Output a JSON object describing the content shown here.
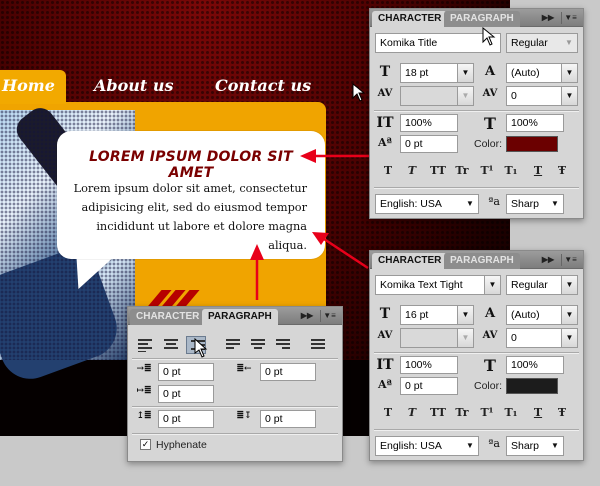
{
  "mockup": {
    "nav": [
      "Home",
      "About us",
      "Contact us"
    ],
    "bubble": {
      "title": "LOREM IPSUM DOLOR SIT AMET",
      "body": "Lorem ipsum dolor sit amet, consectetur adipisicing elit, sed do eiusmod tempor incididunt ut labore et dolore magna aliqua."
    },
    "colors": {
      "nav_tab": "#f2a900",
      "title_text": "#7a0000",
      "background": "#4a0202",
      "arrow": "#e8001a"
    }
  },
  "character_top": {
    "tabs": [
      "CHARACTER",
      "PARAGRAPH"
    ],
    "font_family": "Komika Title",
    "font_style": "Regular",
    "font_size": "18 pt",
    "leading": "(Auto)",
    "kerning": "",
    "tracking": "0",
    "vertical_scale": "100%",
    "horizontal_scale": "100%",
    "baseline_shift": "0 pt",
    "color_label": "Color:",
    "color": "#6b0000",
    "style_buttons": [
      "T",
      "T",
      "TT",
      "Tr",
      "T¹",
      "T₁",
      "T",
      "Ŧ"
    ],
    "language": "English: USA",
    "aa_label": "a",
    "antialias": "Sharp"
  },
  "character_bottom": {
    "tabs": [
      "CHARACTER",
      "PARAGRAPH"
    ],
    "font_family": "Komika Text Tight",
    "font_style": "Regular",
    "font_size": "16 pt",
    "leading": "(Auto)",
    "kerning": "",
    "tracking": "0",
    "vertical_scale": "100%",
    "horizontal_scale": "100%",
    "baseline_shift": "0 pt",
    "color_label": "Color:",
    "color": "#1c1c1c",
    "style_buttons": [
      "T",
      "T",
      "TT",
      "Tr",
      "T¹",
      "T₁",
      "T",
      "Ŧ"
    ],
    "language": "English: USA",
    "aa_label": "a",
    "antialias": "Sharp"
  },
  "paragraph": {
    "tabs": [
      "CHARACTER",
      "PARAGRAPH"
    ],
    "indent_left": "0 pt",
    "indent_right": "0 pt",
    "indent_first": "0 pt",
    "space_before": "0 pt",
    "space_after": "0 pt",
    "hyphenate_label": "Hyphenate",
    "hyphenate_checked": true
  }
}
